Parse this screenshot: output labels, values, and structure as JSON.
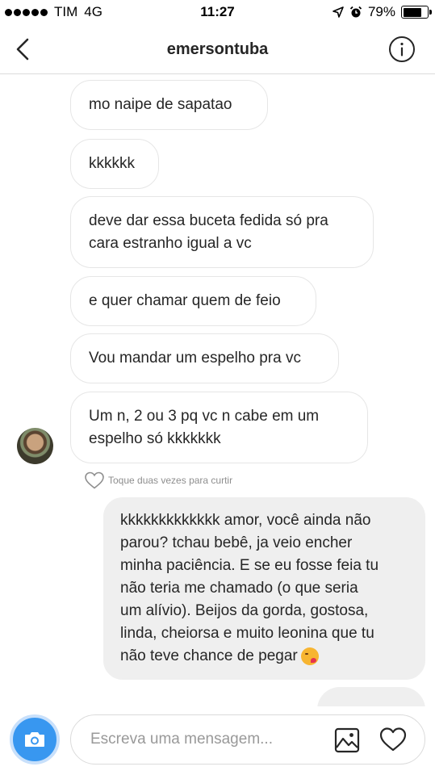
{
  "status_bar": {
    "carrier": "TIM",
    "network": "4G",
    "time": "11:27",
    "battery": "79%",
    "battery_level": 0.79,
    "icons": [
      "signal-dots-icon",
      "location-arrow-icon",
      "alarm-clock-icon",
      "battery-icon"
    ]
  },
  "header": {
    "title": "emersontuba",
    "back_icon": "chevron-left-icon",
    "info_icon": "info-icon"
  },
  "messages": [
    {
      "direction": "in",
      "text": "mo  naipe de sapatao"
    },
    {
      "direction": "in",
      "text": "kkkkkk"
    },
    {
      "direction": "in",
      "text": "deve dar essa buceta fedida só pra\ncara estranho igual a vc"
    },
    {
      "direction": "in",
      "text": "e quer chamar quem de feio"
    },
    {
      "direction": "in",
      "text": "Vou mandar um espelho pra vc"
    },
    {
      "direction": "in",
      "text": "Um n, 2 ou 3 pq  vc n cabe em um\nespelho só kkkkkkk"
    },
    {
      "direction": "out",
      "text": "kkkkkkkkkkkkk amor, você ainda não\nparou? tchau bebê, ja veio encher\nminha paciência. E se eu fosse feia tu\nnão teria me chamado (o que seria\num alívio). Beijos da gorda, gostosa,\nlinda, cheiorsa e muito leonina que tu\nnão teve chance de pegar",
      "emoji": "face-blowing-kiss"
    }
  ],
  "like_hint": "Toque duas vezes para curtir",
  "composer": {
    "placeholder": "Escreva uma mensagem...",
    "value": "",
    "icons": [
      "camera-icon",
      "gallery-icon",
      "heart-icon"
    ]
  },
  "colors": {
    "accent": "#3897f0",
    "bubble_out": "#efefef",
    "bubble_border": "#e6e6e6",
    "text": "#262626",
    "muted": "#8e8e8e"
  }
}
